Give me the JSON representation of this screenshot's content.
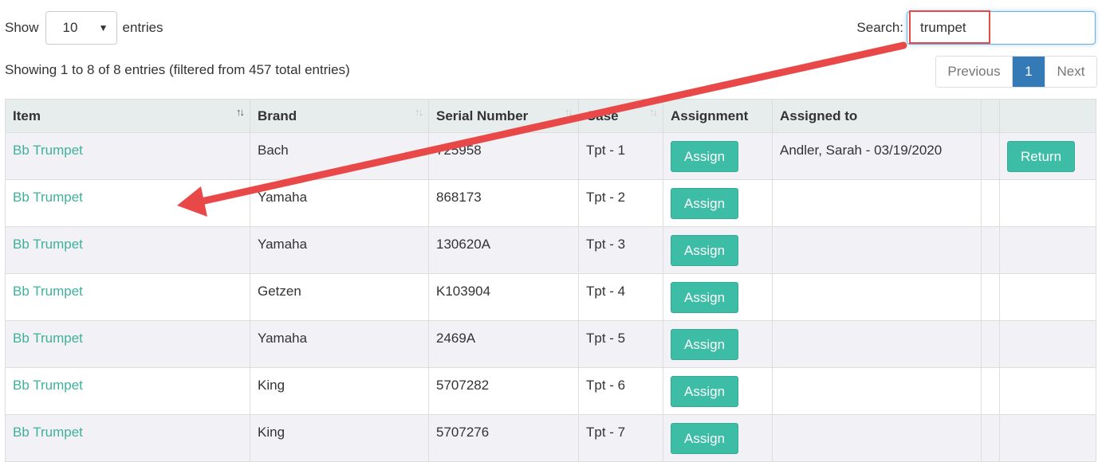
{
  "length": {
    "show_label": "Show",
    "value": "10",
    "entries_label": "entries"
  },
  "search": {
    "label": "Search:",
    "value": "trumpet"
  },
  "info": "Showing 1 to 8 of 8 entries (filtered from 457 total entries)",
  "pagination": {
    "previous": "Previous",
    "current": "1",
    "next": "Next"
  },
  "table": {
    "headers": {
      "item": "Item",
      "brand": "Brand",
      "serial": "Serial Number",
      "case": "Case",
      "assignment": "Assignment",
      "assigned_to": "Assigned to"
    },
    "assign_label": "Assign",
    "return_label": "Return",
    "rows": [
      {
        "item": "Bb Trumpet",
        "brand": "Bach",
        "serial": "725958",
        "case": "Tpt - 1",
        "assigned_to": "Andler, Sarah - 03/19/2020"
      },
      {
        "item": "Bb Trumpet",
        "brand": "Yamaha",
        "serial": "868173",
        "case": "Tpt - 2",
        "assigned_to": ""
      },
      {
        "item": "Bb Trumpet",
        "brand": "Yamaha",
        "serial": "130620A",
        "case": "Tpt - 3",
        "assigned_to": ""
      },
      {
        "item": "Bb Trumpet",
        "brand": "Getzen",
        "serial": "K103904",
        "case": "Tpt - 4",
        "assigned_to": ""
      },
      {
        "item": "Bb Trumpet",
        "brand": "Yamaha",
        "serial": "2469A",
        "case": "Tpt - 5",
        "assigned_to": ""
      },
      {
        "item": "Bb Trumpet",
        "brand": "King",
        "serial": "5707282",
        "case": "Tpt - 6",
        "assigned_to": ""
      },
      {
        "item": "Bb Trumpet",
        "brand": "King",
        "serial": "5707276",
        "case": "Tpt - 7",
        "assigned_to": ""
      }
    ]
  },
  "colors": {
    "link": "#3fb19b",
    "button": "#3dbca6",
    "header_bg": "#e7edec",
    "page_active": "#337ab7",
    "annotation": "#e84848"
  },
  "icons": {
    "sort": "sort-arrows-icon",
    "dropdown": "caret-down-icon"
  }
}
